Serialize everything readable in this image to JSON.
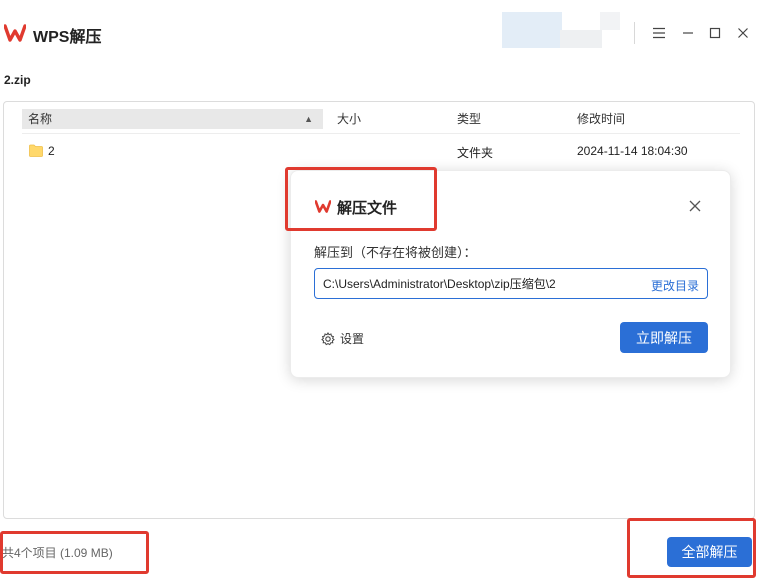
{
  "app": {
    "title": "WPS解压",
    "brand_color": "#e03a2f",
    "accent_color": "#2b6fd6"
  },
  "archive": {
    "name": "2.zip"
  },
  "window_controls": {
    "menu_icon": "hamburger-menu-icon",
    "minimize_icon": "minimize-icon",
    "maximize_icon": "maximize-icon",
    "close_icon": "close-icon"
  },
  "table": {
    "columns": {
      "name": "名称",
      "size": "大小",
      "type": "类型",
      "modified": "修改时间"
    },
    "sort_indicator": "▲",
    "rows": [
      {
        "icon": "folder-icon",
        "name": "2",
        "size": "",
        "type": "文件夹",
        "modified": "2024-11-14 18:04:30"
      }
    ]
  },
  "dialog": {
    "title": "解压文件",
    "label": "解压到（不存在将被创建）：",
    "path_value": "C:\\Users\\Administrator\\Desktop\\zip压缩包\\2",
    "change_dir": "更改目录",
    "settings": "设置",
    "extract_now": "立即解压"
  },
  "status": {
    "summary": "共4个项目 (1.09 MB)"
  },
  "footer": {
    "extract_all": "全部解压"
  },
  "annotation_color": "#e03a2f"
}
